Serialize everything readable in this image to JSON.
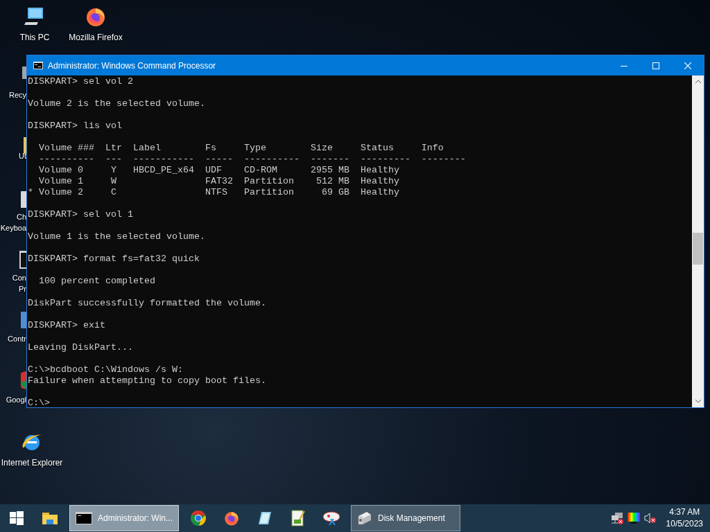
{
  "desktop_icons": [
    {
      "label": [
        "This PC"
      ]
    },
    {
      "label": [
        "Mozilla Firefox"
      ]
    },
    {
      "label": [
        "Recy"
      ]
    },
    {
      "label": [
        "Ut"
      ]
    },
    {
      "label": [
        "Ch",
        "Keyboa"
      ]
    },
    {
      "label": [
        "Con",
        "Pr"
      ]
    },
    {
      "label": [
        "Contr"
      ]
    },
    {
      "label": [
        "Googl"
      ]
    },
    {
      "label": [
        "Internet Explorer"
      ]
    }
  ],
  "window": {
    "title": "Administrator: Windows Command Processor",
    "console_blocks": [
      [
        "DISKPART> sel vol 2"
      ],
      [
        "Volume 2 is the selected volume."
      ],
      [
        "DISKPART> lis vol"
      ],
      [
        "  Volume ###  Ltr  Label        Fs     Type        Size     Status     Info",
        "  ----------  ---  -----------  -----  ----------  -------  ---------  --------",
        "  Volume 0     Y   HBCD_PE_x64  UDF    CD-ROM      2955 MB  Healthy",
        "  Volume 1     W                FAT32  Partition    512 MB  Healthy",
        "* Volume 2     C                NTFS   Partition     69 GB  Healthy"
      ],
      [
        "DISKPART> sel vol 1"
      ],
      [
        "Volume 1 is the selected volume."
      ],
      [
        "DISKPART> format fs=fat32 quick"
      ],
      [
        "  100 percent completed"
      ],
      [
        "DiskPart successfully formatted the volume."
      ],
      [
        "DISKPART> exit"
      ],
      [
        "Leaving DiskPart..."
      ],
      [
        "C:\\>bcdboot C:\\Windows /s W:",
        "Failure when attempting to copy boot files."
      ],
      [
        "C:\\>"
      ]
    ]
  },
  "taskbar": {
    "tasks": [
      {
        "label": "Administrator: Win...",
        "selected": true
      },
      {
        "label": "Disk Management",
        "selected": false
      }
    ],
    "time": "4:37 AM",
    "date": "10/5/2023"
  }
}
